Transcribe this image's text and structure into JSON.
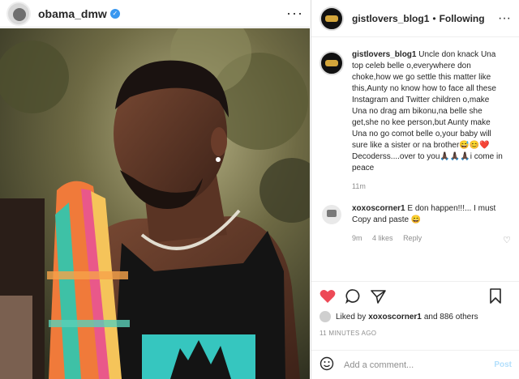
{
  "left": {
    "username": "obama_dmw",
    "verified_icon": "verified-badge-icon",
    "more_label": "···"
  },
  "right": {
    "header": {
      "username": "gistlovers_blog1",
      "separator": "•",
      "follow_status": "Following",
      "more_label": "···"
    },
    "caption": {
      "username": "gistlovers_blog1",
      "text": "Uncle don knack Una top celeb belle o,everywhere don choke,how we go settle this matter like this,Aunty no know how to face all these Instagram and Twitter children o,make Una no drag am bikonu,na belle she get,she no kee person,but Aunty make Una no go comot belle o,your baby will sure like a sister or na brother😅😊❤️ Decoderss....over to you🙏🏿🙏🏿🙏🏿i come in peace",
      "time": "11m"
    },
    "comment": {
      "username": "xoxoscorner1",
      "text": "E don happen!!!... I must Copy and paste 😄",
      "time": "9m",
      "likes": "4 likes",
      "reply": "Reply"
    },
    "likes_text_prefix": "Liked by",
    "likes_user": "xoxoscorner1",
    "likes_suffix": "and 886 others",
    "timestamp": "11 MINUTES AGO",
    "add_comment_placeholder": "Add a comment...",
    "post_label": "Post"
  }
}
